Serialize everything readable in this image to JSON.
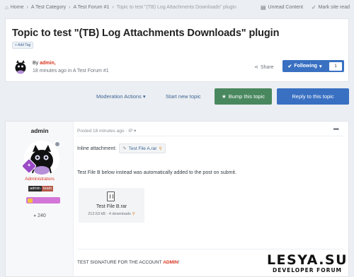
{
  "breadcrumb": {
    "items": [
      "Home",
      "A Test Category",
      "A Test Forum #1",
      "Topic to test \"(TB) Log Attachments Downloads\" plugin"
    ]
  },
  "top_actions": {
    "unread": "Unread Content",
    "mark_read": "Mark site read"
  },
  "topic": {
    "title": "Topic to test \"(TB) Log Attachments Downloads\" plugin",
    "add_tag": "Add Tag",
    "by_prefix": "By",
    "author": "admin,",
    "time_forum": "18 minutes ago in A Test Forum #1",
    "share": "Share",
    "following": "Following",
    "follow_count": "1"
  },
  "actions": {
    "moderation": "Moderation Actions",
    "start_new": "Start new topic",
    "bump": "Bump this topic",
    "reply": "Reply to this topic"
  },
  "post": {
    "author": "admin",
    "group": "Administrators",
    "badge_admin": "admin",
    "badge_team": "team",
    "post_count": "240",
    "meta": "Posted 18 minutes ago · IP",
    "inline_label": "Inline attachment:",
    "inline_file": "Test File A.rar",
    "body_text": "Test File B below instead was automatically added to the post on submit.",
    "file_name": "Test File B.rar",
    "file_info": "212.63 kB · 4 downloads",
    "signature_prefix": "TEST SIGNATURE FOR THE ACCOUNT",
    "signature_name": "ADMIN",
    "signature_suffix": "!"
  },
  "watermark": {
    "title": "LESYA.SU",
    "subtitle": "DEVELOPER FORUM"
  },
  "colors": {
    "accent_blue": "#3970c2",
    "bump_green": "#49885e",
    "admin_red": "#d9351e",
    "page_bg": "#ebeef2"
  }
}
